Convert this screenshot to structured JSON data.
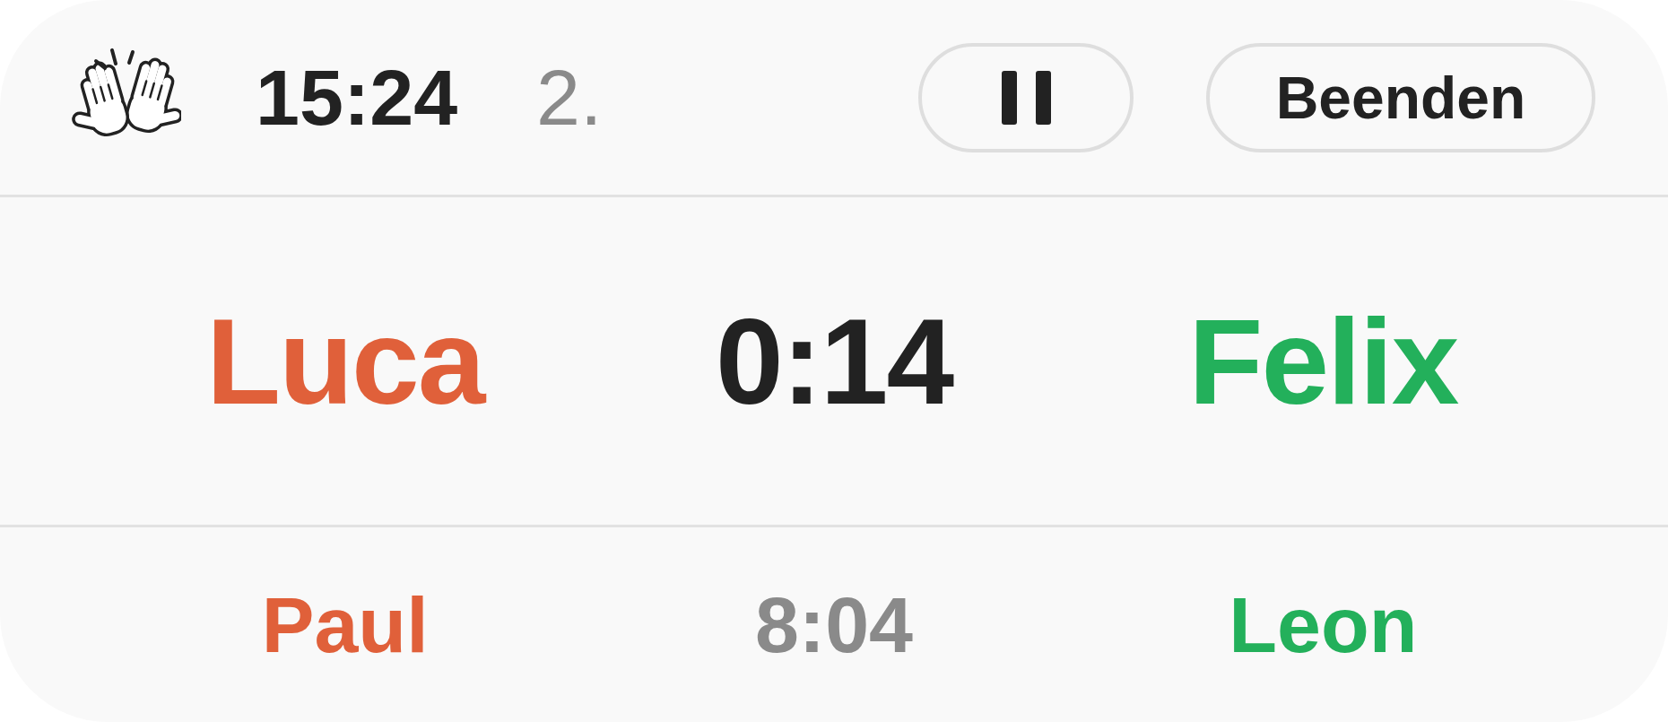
{
  "header": {
    "clock": "15:24",
    "period": "2.",
    "buttons": [
      {
        "kind": "pause"
      },
      {
        "kind": "label",
        "label": "Beenden"
      }
    ]
  },
  "current_match": {
    "players": [
      {
        "name": "Luca",
        "color": "#e0603a"
      },
      {
        "name": "Felix",
        "color": "#23b05b"
      }
    ],
    "time": "0:14"
  },
  "next_match": {
    "players": [
      {
        "name": "Paul",
        "color": "#e0603a"
      },
      {
        "name": "Leon",
        "color": "#23b05b"
      }
    ],
    "time": "8:04"
  }
}
